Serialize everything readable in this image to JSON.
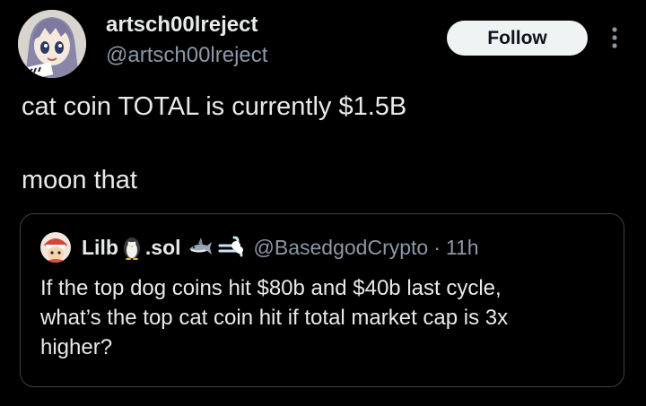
{
  "author": {
    "name": "artsch00lreject",
    "handle": "@artsch00lreject",
    "avatar_icon": "anime-character-avatar-icon"
  },
  "actions": {
    "follow_label": "Follow",
    "more_icon": "more-options-icon"
  },
  "tweet": {
    "line1": "cat coin TOTAL is currently $1.5B",
    "line2": "moon that"
  },
  "quote": {
    "name_part1": "Lilb",
    "name_part2": ".sol",
    "name_emojis": [
      "penguin-icon",
      "shark-icon",
      "dash-icon"
    ],
    "handle": "@BasedgodCrypto",
    "separator": "·",
    "time": "11h",
    "body_lines": [
      "If the top dog coins hit $80b and $40b last cycle,",
      "what’s the top cat coin hit if total market cap is 3x",
      "higher?"
    ]
  },
  "colors": {
    "background": "#000000",
    "text": "#e7e9ea",
    "muted": "#8b98a5",
    "border": "#3a4046",
    "button_bg": "#eff3f4"
  }
}
